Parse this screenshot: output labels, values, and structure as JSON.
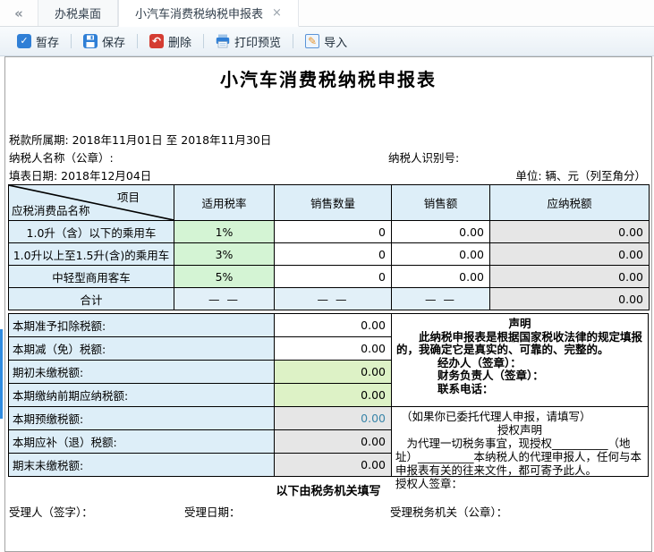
{
  "tabbar": {
    "collapse_icon": "«",
    "tabs": [
      {
        "label": "办税桌面"
      },
      {
        "label": "小汽车消费税纳税申报表",
        "close_icon": "×"
      }
    ]
  },
  "toolbar": {
    "buttons": [
      {
        "label": "暂存",
        "icon": "check-square"
      },
      {
        "label": "保存",
        "icon": "floppy-disk"
      },
      {
        "label": "删除",
        "icon": "undo-red"
      },
      {
        "label": "打印预览",
        "icon": "printer"
      },
      {
        "label": "导入",
        "icon": "pencil-box"
      }
    ],
    "icon_glyphs": {
      "check": "✓",
      "undo": "↶",
      "pencil": "✎"
    }
  },
  "form": {
    "title": "小汽车消费税纳税申报表",
    "tax_period": "税款所属期: 2018年11月01日  至  2018年11月30日",
    "taxpayer_name_label": "纳税人名称（公章）:",
    "taxpayer_id_label": "纳税人识别号:",
    "fill_date": "填表日期: 2018年12月04日",
    "unit_note": "单位: 辆、元（列至角分）"
  },
  "main_table": {
    "diagonal_top": "项目",
    "diagonal_bottom": "应税消费品名称",
    "headers": [
      "适用税率",
      "销售数量",
      "销售额",
      "应纳税额"
    ],
    "rows": [
      {
        "name": "1.0升（含）以下的乘用车",
        "rate": "1%",
        "qty": "0",
        "sales": "0.00",
        "tax": "0.00"
      },
      {
        "name": "1.0升以上至1.5升(含)的乘用车",
        "rate": "3%",
        "qty": "0",
        "sales": "0.00",
        "tax": "0.00"
      },
      {
        "name": "中轻型商用客车",
        "rate": "5%",
        "qty": "0",
        "sales": "0.00",
        "tax": "0.00"
      },
      {
        "name": "合计",
        "rate": "— —",
        "qty": "— —",
        "sales": "— —",
        "tax": "0.00"
      }
    ]
  },
  "summary": {
    "rows": [
      {
        "label": "本期准予扣除税额:",
        "value": "0.00"
      },
      {
        "label": "本期减（免）税额:",
        "value": "0.00"
      },
      {
        "label": "期初未缴税额:",
        "value": "0.00"
      },
      {
        "label": "本期缴纳前期应纳税额:",
        "value": "0.00"
      },
      {
        "label": "本期预缴税额:",
        "value": "0.00"
      },
      {
        "label": "本期应补（退）税额:",
        "value": "0.00"
      },
      {
        "label": "期末未缴税额:",
        "value": "0.00"
      }
    ]
  },
  "declaration": {
    "heading": "声明",
    "body": "此纳税申报表是根据国家税收法律的规定填报的，我确定它是真实的、可靠的、完整的。",
    "agent_line": "经办人（签章）：",
    "cfo_line": "财务负责人（签章）：",
    "phone_line": "联系电话："
  },
  "authorization": {
    "note": "（如果你已委托代理人申报，请填写）",
    "heading": "授权声明",
    "body": "为代理一切税务事宜，现授权__________（地址）__________本纳税人的代理申报人，任何与本申报表有关的往来文件，都可寄予此人。",
    "sign_line": "授权人签章："
  },
  "footer": {
    "heading": "以下由税务机关填写",
    "receiver_label": "受理人（签字）：",
    "date_label": "受理日期：",
    "authority_label": "受理税务机关（公章）："
  },
  "colors": {
    "accent_blue": "#2f7fd6",
    "delete_red": "#d43c32",
    "pencil_orange": "#e8952d",
    "cell_blue": "#ddeef8",
    "cell_green_rate": "#d4f4d4",
    "cell_green_value": "#ddf2c6",
    "cell_gray": "#e6e6e6",
    "link_blue": "#3a85a8",
    "scroll_thumb_blue": "#2f8be0"
  }
}
